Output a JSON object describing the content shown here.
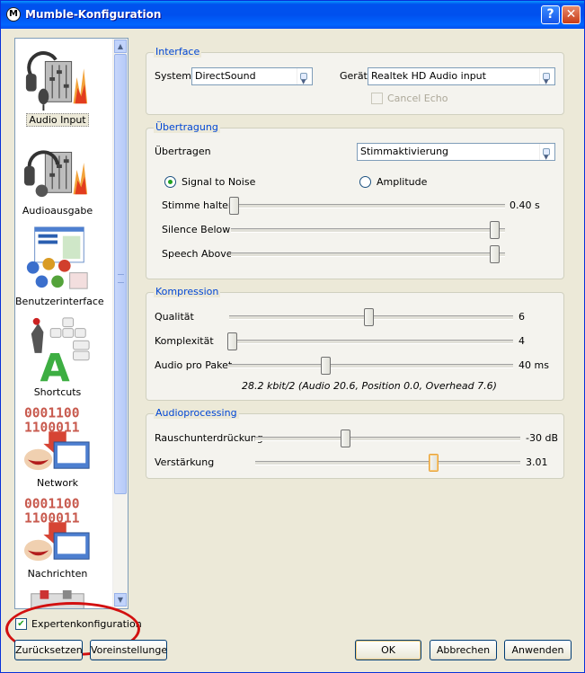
{
  "window": {
    "title": "Mumble-Konfiguration",
    "help_glyph": "?",
    "close_glyph": "✕",
    "app_glyph": "M"
  },
  "sidebar": {
    "items": [
      {
        "label": "Audio Input",
        "icon": "audio-input-icon",
        "selected": true
      },
      {
        "label": "Audioausgabe",
        "icon": "audio-output-icon"
      },
      {
        "label": "Benutzerinterface",
        "icon": "user-interface-icon"
      },
      {
        "label": "Shortcuts",
        "icon": "shortcuts-icon"
      },
      {
        "label": "Network",
        "icon": "network-icon"
      },
      {
        "label": "Nachrichten",
        "icon": "messages-icon"
      }
    ],
    "scroll_up": "▲",
    "scroll_down": "▼"
  },
  "interface": {
    "title": "Interface",
    "system_label": "System",
    "system_value": "DirectSound",
    "device_label": "Gerät",
    "device_value": "Realtek HD Audio input",
    "cancel_echo_label": "Cancel Echo",
    "cancel_echo_checked": false
  },
  "transmission": {
    "title": "Übertragung",
    "transmit_label": "Übertragen",
    "transmit_value": "Stimmaktivierung",
    "radio_snr_label": "Signal to Noise",
    "radio_amp_label": "Amplitude",
    "selected_radio": "Signal to Noise",
    "hold_label": "Stimme halten",
    "hold_value_text": "0.40 s",
    "hold_level": 0.01,
    "silence_label": "Silence Below",
    "silence_level": 0.96,
    "speech_label": "Speech Above",
    "speech_level": 0.96
  },
  "compression": {
    "title": "Kompression",
    "quality_label": "Qualität",
    "quality_value": "6",
    "quality_level": 0.49,
    "complexity_label": "Komplexität",
    "complexity_value": "4",
    "complexity_level": 0.01,
    "frames_label": "Audio pro Paket",
    "frames_value": "40 ms",
    "frames_level": 0.34,
    "info_text": "28.2 kbit/2 (Audio 20.6, Position 0.0, Overhead 7.6)"
  },
  "processing": {
    "title": "Audioprocessing",
    "noise_label": "Rauschunterdrückung",
    "noise_value": "-30 dB",
    "noise_level": 0.34,
    "amp_label": "Verstärkung",
    "amp_value": "3.01",
    "amp_level": 0.67
  },
  "footer": {
    "expert_label": "Expertenkonfiguration",
    "expert_checked": true,
    "reset_label": "Zurücksetzen",
    "defaults_label": "Voreinstellungen",
    "ok_label": "OK",
    "cancel_label": "Abbrechen",
    "apply_label": "Anwenden"
  },
  "colors": {
    "group_title": "#0046d5",
    "highlight": "#d21010",
    "titlebar": "#0053ee"
  }
}
